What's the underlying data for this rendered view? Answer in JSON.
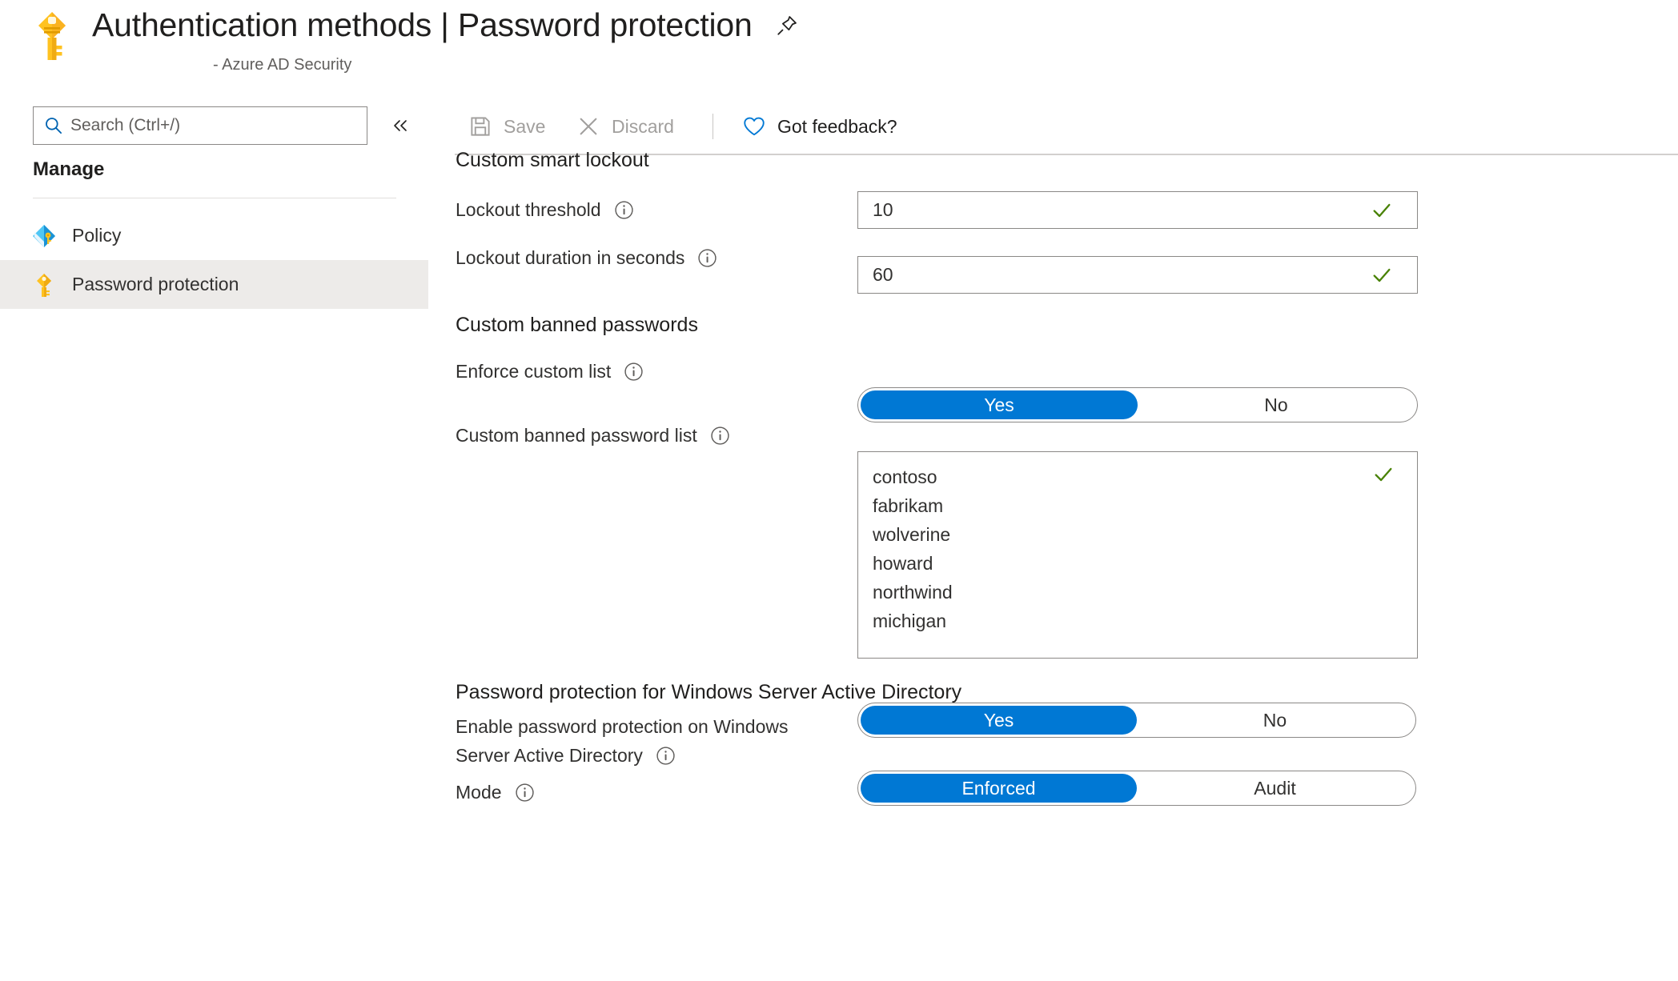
{
  "header": {
    "icon": "key-icon",
    "title": "Authentication methods | Password protection",
    "subtitle": "- Azure AD Security",
    "pin_icon": "pin-icon"
  },
  "sidebar": {
    "search": {
      "value": "",
      "placeholder": "Search (Ctrl+/)",
      "icon": "search-icon"
    },
    "collapse_icon": "chevron-double-left-icon",
    "group_label": "Manage",
    "items": [
      {
        "label": "Policy",
        "icon": "policy-icon",
        "selected": false
      },
      {
        "label": "Password protection",
        "icon": "key-icon",
        "selected": true
      }
    ]
  },
  "toolbar": {
    "save_label": "Save",
    "save_icon": "save-icon",
    "save_disabled": true,
    "discard_label": "Discard",
    "discard_icon": "close-icon",
    "discard_disabled": true,
    "feedback_label": "Got feedback?",
    "feedback_icon": "heart-icon"
  },
  "main": {
    "sections": [
      {
        "title": "Custom smart lockout"
      },
      {
        "title": "Custom banned passwords"
      },
      {
        "title": "Password protection for Windows Server Active Directory"
      }
    ],
    "lockout_threshold": {
      "label": "Lockout threshold",
      "value": "10",
      "valid": true,
      "validation_icon": "checkmark-icon"
    },
    "lockout_duration": {
      "label": "Lockout duration in seconds",
      "value": "60",
      "valid": true,
      "validation_icon": "checkmark-icon"
    },
    "enforce_custom_list": {
      "label": "Enforce custom list",
      "options": [
        "Yes",
        "No"
      ],
      "selected": "Yes"
    },
    "custom_banned_password_list": {
      "label": "Custom banned password list",
      "entries": [
        "contoso",
        "fabrikam",
        "wolverine",
        "howard",
        "northwind",
        "michigan"
      ],
      "valid": true,
      "validation_icon": "checkmark-icon"
    },
    "enable_on_windows_server_ad": {
      "label_line1": "Enable password protection on Windows",
      "label_line2": "Server Active Directory",
      "options": [
        "Yes",
        "No"
      ],
      "selected": "Yes"
    },
    "mode": {
      "label": "Mode",
      "options": [
        "Enforced",
        "Audit"
      ],
      "selected": "Enforced"
    }
  },
  "colors": {
    "accent_blue": "#0078d4",
    "valid_green": "#498205",
    "selected_nav_bg": "#edebe9",
    "disabled_text": "#a19f9d",
    "border_gray": "#8a8886"
  }
}
